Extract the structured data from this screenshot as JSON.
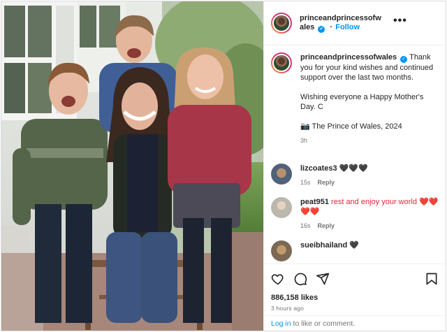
{
  "post": {
    "username": "princeandprincessofwales",
    "follow_label": "Follow",
    "more_label": "•••"
  },
  "caption": {
    "text": "Thank you for your kind wishes and continued support over the last two months.\n\nWishing everyone a Happy Mother's Day. C\n\n📷 The Prince of Wales, 2024",
    "time": "3h"
  },
  "comments": [
    {
      "user": "lizcoates3",
      "text": "🖤🖤🖤",
      "time": "15s",
      "reply": "Reply"
    },
    {
      "user": "peat951",
      "text": "rest and enjoy your world ❤️❤️ ❤️❤️",
      "time": "16s",
      "reply": "Reply"
    },
    {
      "user": "sueibhailand",
      "text": "🖤",
      "time": "",
      "reply": ""
    }
  ],
  "actions": {
    "likes": "886,158 likes",
    "posted": "3 hours ago"
  },
  "login": {
    "link": "Log in",
    "rest": " to like or comment."
  },
  "colors": {
    "accent": "#0095f6",
    "muted": "#737373",
    "border": "#dbdbdb"
  },
  "icons": [
    "heart-icon",
    "comment-icon",
    "share-icon",
    "bookmark-icon",
    "verified-icon",
    "more-icon"
  ]
}
